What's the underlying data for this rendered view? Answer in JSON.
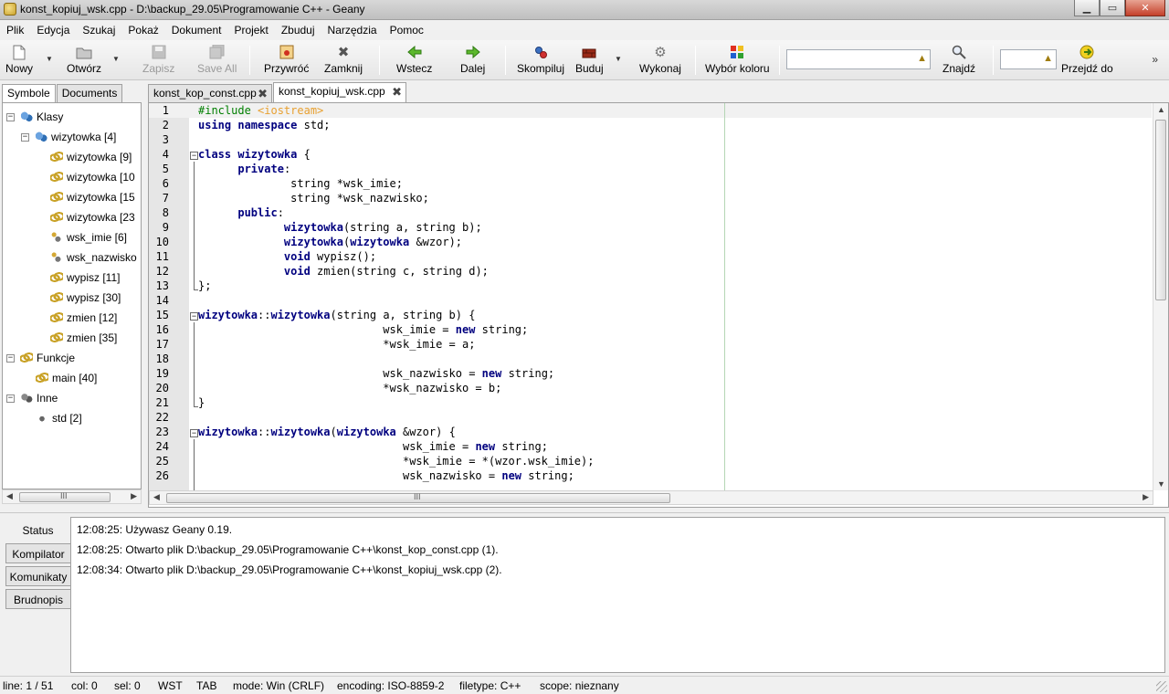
{
  "window": {
    "title": "konst_kopiuj_wsk.cpp - D:\\backup_29.05\\Programowanie C++ - Geany",
    "minimize": "▁",
    "maximize": "▭",
    "close": "✕"
  },
  "menu": [
    "Plik",
    "Edycja",
    "Szukaj",
    "Pokaż",
    "Dokument",
    "Projekt",
    "Zbuduj",
    "Narzędzia",
    "Pomoc"
  ],
  "toolbar": {
    "new": "Nowy",
    "open": "Otwórz",
    "save": "Zapisz",
    "save_all": "Save All",
    "revert": "Przywróć",
    "close": "Zamknij",
    "back": "Wstecz",
    "forward": "Dalej",
    "compile": "Skompiluj",
    "build": "Buduj",
    "execute": "Wykonaj",
    "color": "Wybór koloru",
    "find": "Znajdź",
    "goto": "Przejdź do",
    "search_value": "",
    "goto_value": "",
    "overflow": "»"
  },
  "sidebar": {
    "tabs": [
      "Symbole",
      "Documents"
    ],
    "tree": [
      {
        "label": "Klasy",
        "expander": "−",
        "icon": "class"
      },
      {
        "label": "wizytowka [4]",
        "expander": "−",
        "icon": "class"
      },
      {
        "label": "wizytowka [9]",
        "icon": "method"
      },
      {
        "label": "wizytowka [10",
        "icon": "method"
      },
      {
        "label": "wizytowka [15",
        "icon": "method"
      },
      {
        "label": "wizytowka [23",
        "icon": "method"
      },
      {
        "label": "wsk_imie [6]",
        "icon": "member"
      },
      {
        "label": "wsk_nazwisko",
        "icon": "member"
      },
      {
        "label": "wypisz [11]",
        "icon": "method"
      },
      {
        "label": "wypisz [30]",
        "icon": "method"
      },
      {
        "label": "zmien [12]",
        "icon": "method"
      },
      {
        "label": "zmien [35]",
        "icon": "method"
      },
      {
        "label": "Funkcje",
        "expander": "−",
        "icon": "method"
      },
      {
        "label": "main [40]",
        "icon": "method"
      },
      {
        "label": "Inne",
        "expander": "−",
        "icon": "misc"
      },
      {
        "label": "std [2]",
        "icon": "namespace"
      }
    ],
    "scroll_thumb": "III"
  },
  "documents": [
    {
      "name": "konst_kop_const.cpp",
      "close": "✖"
    },
    {
      "name": "konst_kopiuj_wsk.cpp",
      "close": "✖"
    }
  ],
  "editor": {
    "lines": [
      {
        "n": "1",
        "tokens": [
          {
            "t": "#include ",
            "c": "pre"
          },
          {
            "t": "<iostream>",
            "c": "inc"
          }
        ]
      },
      {
        "n": "2",
        "tokens": [
          {
            "t": "using namespace ",
            "c": "kw"
          },
          {
            "t": "std;",
            "c": "txt"
          }
        ]
      },
      {
        "n": "3",
        "tokens": []
      },
      {
        "n": "4",
        "tokens": [
          {
            "t": "class ",
            "c": "kw"
          },
          {
            "t": "wizytowka",
            "c": "cls"
          },
          {
            "t": " {",
            "c": "txt"
          }
        ]
      },
      {
        "n": "5",
        "tokens": [
          {
            "t": "      ",
            "c": "txt"
          },
          {
            "t": "private",
            "c": "kw"
          },
          {
            "t": ":",
            "c": "txt"
          }
        ]
      },
      {
        "n": "6",
        "tokens": [
          {
            "t": "              string *wsk_imie;",
            "c": "txt"
          }
        ]
      },
      {
        "n": "7",
        "tokens": [
          {
            "t": "              string *wsk_nazwisko;",
            "c": "txt"
          }
        ]
      },
      {
        "n": "8",
        "tokens": [
          {
            "t": "      ",
            "c": "txt"
          },
          {
            "t": "public",
            "c": "kw"
          },
          {
            "t": ":",
            "c": "txt"
          }
        ]
      },
      {
        "n": "9",
        "tokens": [
          {
            "t": "             ",
            "c": "txt"
          },
          {
            "t": "wizytowka",
            "c": "cls"
          },
          {
            "t": "(string a, string b);",
            "c": "txt"
          }
        ]
      },
      {
        "n": "10",
        "tokens": [
          {
            "t": "             ",
            "c": "txt"
          },
          {
            "t": "wizytowka",
            "c": "cls"
          },
          {
            "t": "(",
            "c": "txt"
          },
          {
            "t": "wizytowka",
            "c": "cls"
          },
          {
            "t": " &wzor);",
            "c": "txt"
          }
        ]
      },
      {
        "n": "11",
        "tokens": [
          {
            "t": "             ",
            "c": "txt"
          },
          {
            "t": "void",
            "c": "kw"
          },
          {
            "t": " wypisz();",
            "c": "txt"
          }
        ]
      },
      {
        "n": "12",
        "tokens": [
          {
            "t": "             ",
            "c": "txt"
          },
          {
            "t": "void",
            "c": "kw"
          },
          {
            "t": " zmien(string c, string d);",
            "c": "txt"
          }
        ]
      },
      {
        "n": "13",
        "tokens": [
          {
            "t": "};",
            "c": "txt"
          }
        ]
      },
      {
        "n": "14",
        "tokens": []
      },
      {
        "n": "15",
        "tokens": [
          {
            "t": "wizytowka",
            "c": "cls"
          },
          {
            "t": "::",
            "c": "txt"
          },
          {
            "t": "wizytowka",
            "c": "cls"
          },
          {
            "t": "(string a, string b) {",
            "c": "txt"
          }
        ]
      },
      {
        "n": "16",
        "tokens": [
          {
            "t": "                            wsk_imie = ",
            "c": "txt"
          },
          {
            "t": "new",
            "c": "kw"
          },
          {
            "t": " string;",
            "c": "txt"
          }
        ]
      },
      {
        "n": "17",
        "tokens": [
          {
            "t": "                            *wsk_imie = a;",
            "c": "txt"
          }
        ]
      },
      {
        "n": "18",
        "tokens": []
      },
      {
        "n": "19",
        "tokens": [
          {
            "t": "                            wsk_nazwisko = ",
            "c": "txt"
          },
          {
            "t": "new",
            "c": "kw"
          },
          {
            "t": " string;",
            "c": "txt"
          }
        ]
      },
      {
        "n": "20",
        "tokens": [
          {
            "t": "                            *wsk_nazwisko = b;",
            "c": "txt"
          }
        ]
      },
      {
        "n": "21",
        "tokens": [
          {
            "t": "}",
            "c": "txt"
          }
        ]
      },
      {
        "n": "22",
        "tokens": []
      },
      {
        "n": "23",
        "tokens": [
          {
            "t": "wizytowka",
            "c": "cls"
          },
          {
            "t": "::",
            "c": "txt"
          },
          {
            "t": "wizytowka",
            "c": "cls"
          },
          {
            "t": "(",
            "c": "txt"
          },
          {
            "t": "wizytowka",
            "c": "cls"
          },
          {
            "t": " &wzor) {",
            "c": "txt"
          }
        ]
      },
      {
        "n": "24",
        "tokens": [
          {
            "t": "                               wsk_imie = ",
            "c": "txt"
          },
          {
            "t": "new",
            "c": "kw"
          },
          {
            "t": " string;",
            "c": "txt"
          }
        ]
      },
      {
        "n": "25",
        "tokens": [
          {
            "t": "                               *wsk_imie = *(wzor.wsk_imie);",
            "c": "txt"
          }
        ]
      },
      {
        "n": "26",
        "tokens": [
          {
            "t": "                               wsk_nazwisko = ",
            "c": "txt"
          },
          {
            "t": "new",
            "c": "kw"
          },
          {
            "t": " string;",
            "c": "txt"
          }
        ]
      }
    ],
    "scroll_thumb": "III"
  },
  "messages": {
    "tabs": [
      "Status",
      "Kompilator",
      "Komunikaty",
      "Brudnopis"
    ],
    "lines": [
      "12:08:25: Używasz Geany 0.19.",
      "12:08:25: Otwarto plik D:\\backup_29.05\\Programowanie C++\\konst_kop_const.cpp (1).",
      "12:08:34: Otwarto plik D:\\backup_29.05\\Programowanie C++\\konst_kopiuj_wsk.cpp (2)."
    ]
  },
  "status": {
    "line": "line: 1 / 51",
    "col": "col: 0",
    "sel": "sel: 0",
    "ins": "WST",
    "tab": "TAB",
    "mode": "mode: Win (CRLF)",
    "encoding": "encoding: ISO-8859-2",
    "filetype": "filetype: C++",
    "scope": "scope: nieznany"
  },
  "colors": {
    "keyword": "#00007f",
    "preprocessor": "#007f00",
    "include": "#e8a030",
    "edge_line": "#b5d6b5"
  }
}
